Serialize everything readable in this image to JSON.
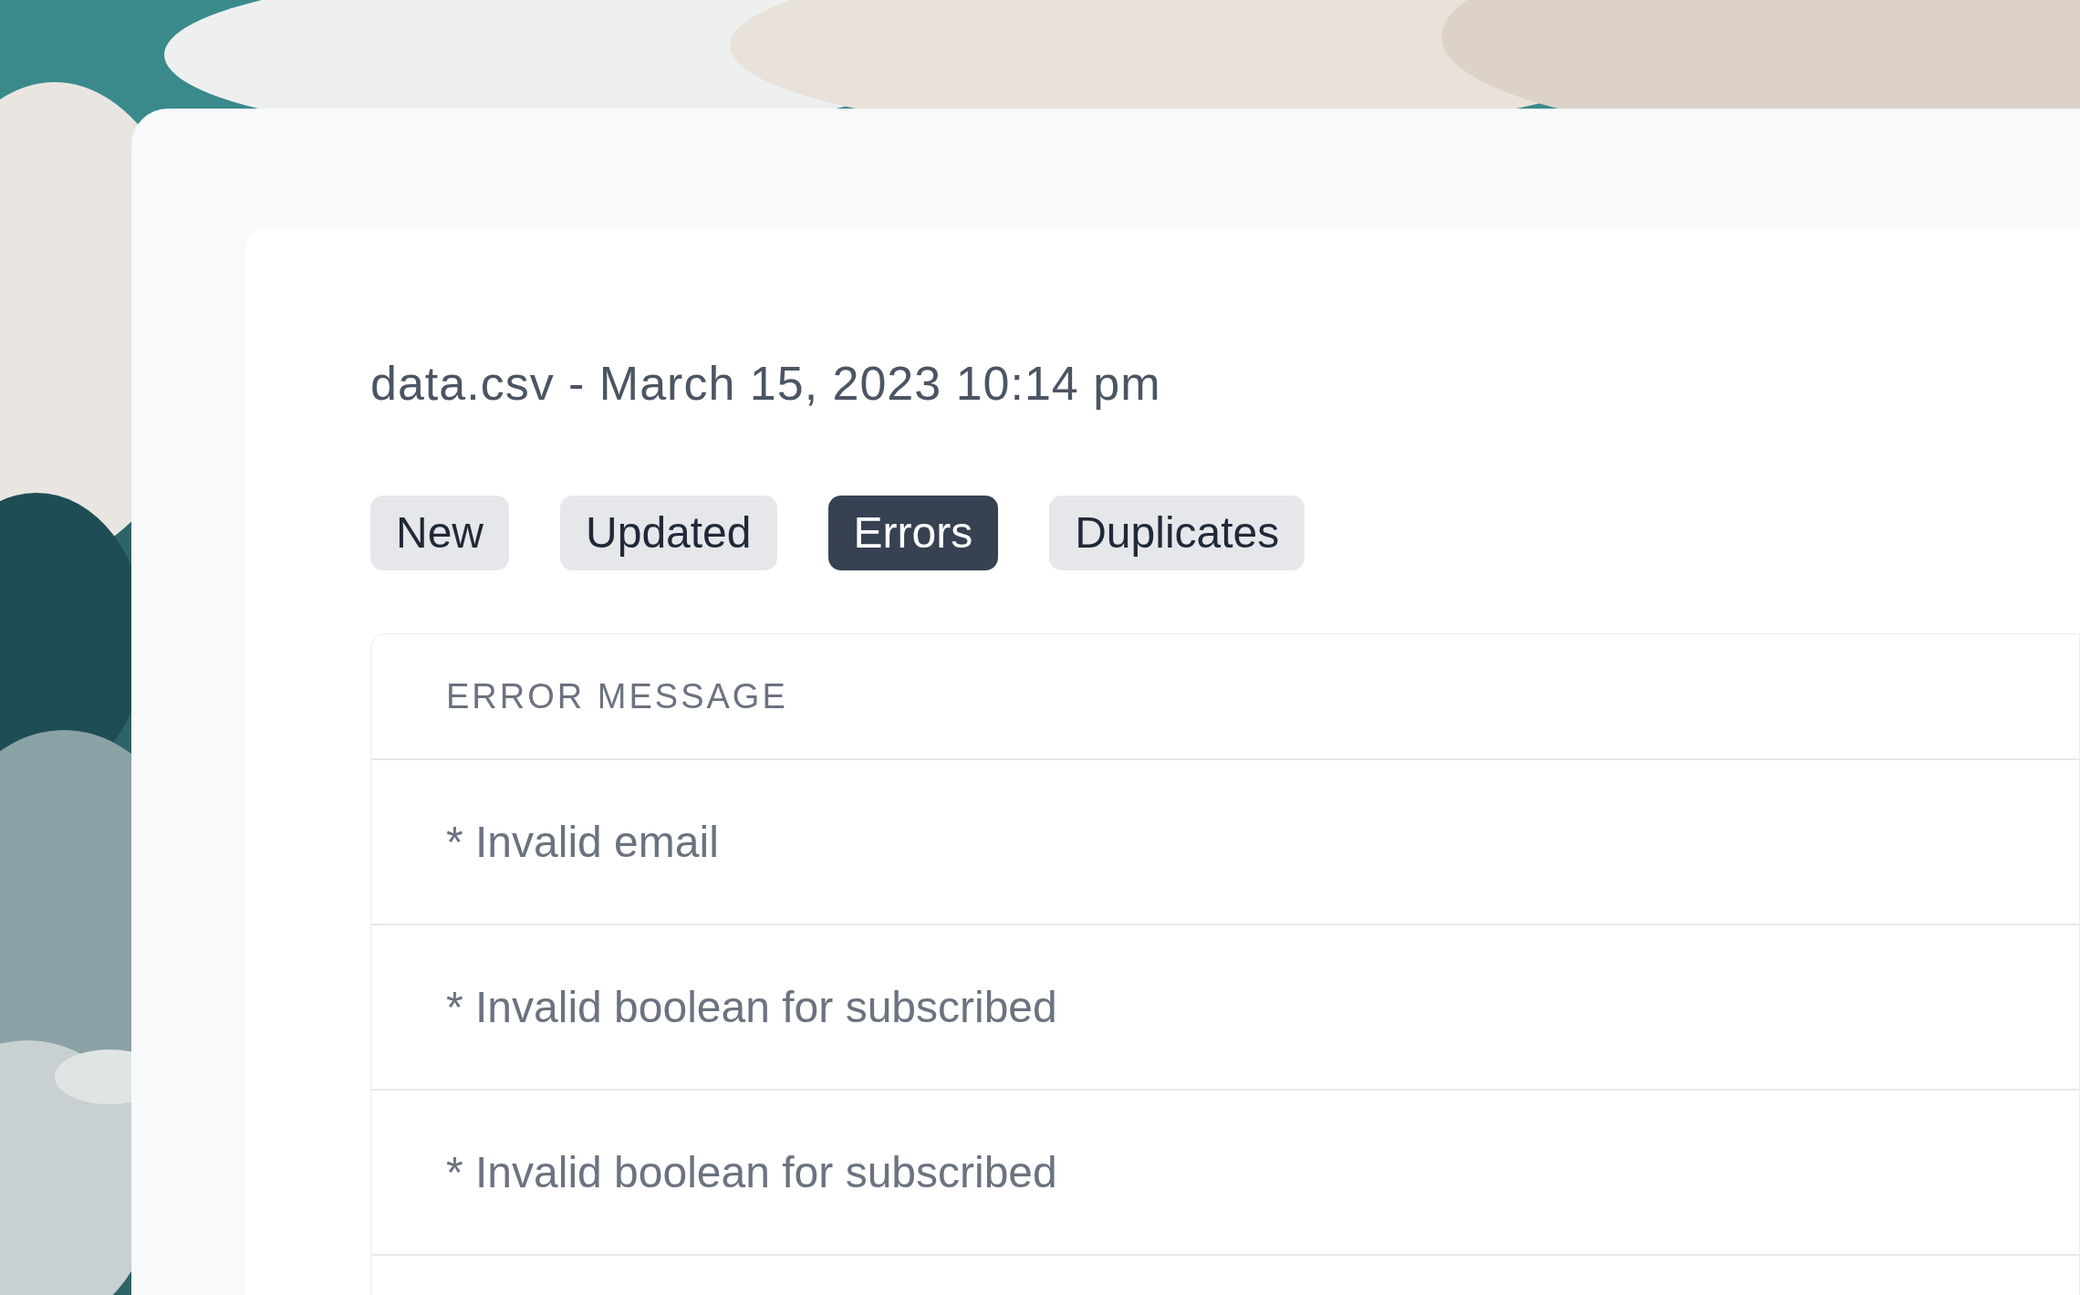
{
  "title": "data.csv - March 15, 2023 10:14 pm",
  "tabs": [
    {
      "label": "New",
      "selected": false
    },
    {
      "label": "Updated",
      "selected": false
    },
    {
      "label": "Errors",
      "selected": true
    },
    {
      "label": "Duplicates",
      "selected": false
    }
  ],
  "table": {
    "columns": [
      "ERROR MESSAGE"
    ],
    "rows": [
      "* Invalid email",
      "* Invalid boolean for subscribed",
      "* Invalid boolean for subscribed"
    ]
  }
}
